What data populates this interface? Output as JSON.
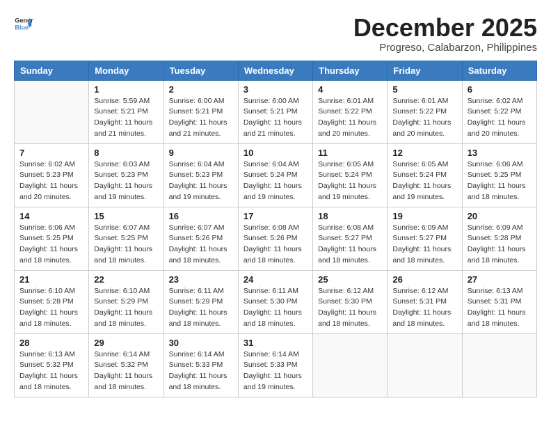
{
  "header": {
    "logo": {
      "general": "General",
      "blue": "Blue"
    },
    "title": "December 2025",
    "location": "Progreso, Calabarzon, Philippines"
  },
  "days_of_week": [
    "Sunday",
    "Monday",
    "Tuesday",
    "Wednesday",
    "Thursday",
    "Friday",
    "Saturday"
  ],
  "weeks": [
    [
      {
        "day": "",
        "info": ""
      },
      {
        "day": "1",
        "info": "Sunrise: 5:59 AM\nSunset: 5:21 PM\nDaylight: 11 hours\nand 21 minutes."
      },
      {
        "day": "2",
        "info": "Sunrise: 6:00 AM\nSunset: 5:21 PM\nDaylight: 11 hours\nand 21 minutes."
      },
      {
        "day": "3",
        "info": "Sunrise: 6:00 AM\nSunset: 5:21 PM\nDaylight: 11 hours\nand 21 minutes."
      },
      {
        "day": "4",
        "info": "Sunrise: 6:01 AM\nSunset: 5:22 PM\nDaylight: 11 hours\nand 20 minutes."
      },
      {
        "day": "5",
        "info": "Sunrise: 6:01 AM\nSunset: 5:22 PM\nDaylight: 11 hours\nand 20 minutes."
      },
      {
        "day": "6",
        "info": "Sunrise: 6:02 AM\nSunset: 5:22 PM\nDaylight: 11 hours\nand 20 minutes."
      }
    ],
    [
      {
        "day": "7",
        "info": "Sunrise: 6:02 AM\nSunset: 5:23 PM\nDaylight: 11 hours\nand 20 minutes."
      },
      {
        "day": "8",
        "info": "Sunrise: 6:03 AM\nSunset: 5:23 PM\nDaylight: 11 hours\nand 19 minutes."
      },
      {
        "day": "9",
        "info": "Sunrise: 6:04 AM\nSunset: 5:23 PM\nDaylight: 11 hours\nand 19 minutes."
      },
      {
        "day": "10",
        "info": "Sunrise: 6:04 AM\nSunset: 5:24 PM\nDaylight: 11 hours\nand 19 minutes."
      },
      {
        "day": "11",
        "info": "Sunrise: 6:05 AM\nSunset: 5:24 PM\nDaylight: 11 hours\nand 19 minutes."
      },
      {
        "day": "12",
        "info": "Sunrise: 6:05 AM\nSunset: 5:24 PM\nDaylight: 11 hours\nand 19 minutes."
      },
      {
        "day": "13",
        "info": "Sunrise: 6:06 AM\nSunset: 5:25 PM\nDaylight: 11 hours\nand 18 minutes."
      }
    ],
    [
      {
        "day": "14",
        "info": "Sunrise: 6:06 AM\nSunset: 5:25 PM\nDaylight: 11 hours\nand 18 minutes."
      },
      {
        "day": "15",
        "info": "Sunrise: 6:07 AM\nSunset: 5:25 PM\nDaylight: 11 hours\nand 18 minutes."
      },
      {
        "day": "16",
        "info": "Sunrise: 6:07 AM\nSunset: 5:26 PM\nDaylight: 11 hours\nand 18 minutes."
      },
      {
        "day": "17",
        "info": "Sunrise: 6:08 AM\nSunset: 5:26 PM\nDaylight: 11 hours\nand 18 minutes."
      },
      {
        "day": "18",
        "info": "Sunrise: 6:08 AM\nSunset: 5:27 PM\nDaylight: 11 hours\nand 18 minutes."
      },
      {
        "day": "19",
        "info": "Sunrise: 6:09 AM\nSunset: 5:27 PM\nDaylight: 11 hours\nand 18 minutes."
      },
      {
        "day": "20",
        "info": "Sunrise: 6:09 AM\nSunset: 5:28 PM\nDaylight: 11 hours\nand 18 minutes."
      }
    ],
    [
      {
        "day": "21",
        "info": "Sunrise: 6:10 AM\nSunset: 5:28 PM\nDaylight: 11 hours\nand 18 minutes."
      },
      {
        "day": "22",
        "info": "Sunrise: 6:10 AM\nSunset: 5:29 PM\nDaylight: 11 hours\nand 18 minutes."
      },
      {
        "day": "23",
        "info": "Sunrise: 6:11 AM\nSunset: 5:29 PM\nDaylight: 11 hours\nand 18 minutes."
      },
      {
        "day": "24",
        "info": "Sunrise: 6:11 AM\nSunset: 5:30 PM\nDaylight: 11 hours\nand 18 minutes."
      },
      {
        "day": "25",
        "info": "Sunrise: 6:12 AM\nSunset: 5:30 PM\nDaylight: 11 hours\nand 18 minutes."
      },
      {
        "day": "26",
        "info": "Sunrise: 6:12 AM\nSunset: 5:31 PM\nDaylight: 11 hours\nand 18 minutes."
      },
      {
        "day": "27",
        "info": "Sunrise: 6:13 AM\nSunset: 5:31 PM\nDaylight: 11 hours\nand 18 minutes."
      }
    ],
    [
      {
        "day": "28",
        "info": "Sunrise: 6:13 AM\nSunset: 5:32 PM\nDaylight: 11 hours\nand 18 minutes."
      },
      {
        "day": "29",
        "info": "Sunrise: 6:14 AM\nSunset: 5:32 PM\nDaylight: 11 hours\nand 18 minutes."
      },
      {
        "day": "30",
        "info": "Sunrise: 6:14 AM\nSunset: 5:33 PM\nDaylight: 11 hours\nand 18 minutes."
      },
      {
        "day": "31",
        "info": "Sunrise: 6:14 AM\nSunset: 5:33 PM\nDaylight: 11 hours\nand 19 minutes."
      },
      {
        "day": "",
        "info": ""
      },
      {
        "day": "",
        "info": ""
      },
      {
        "day": "",
        "info": ""
      }
    ]
  ]
}
